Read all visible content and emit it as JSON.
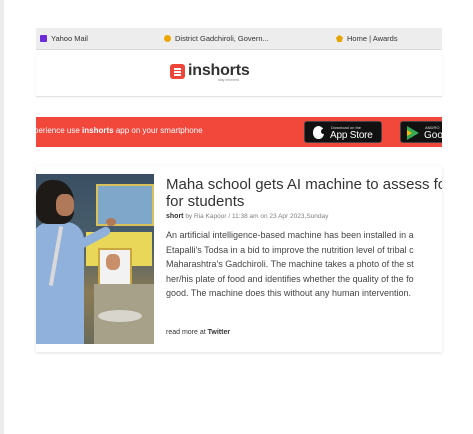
{
  "bookmarks": [
    {
      "label": "Yahoo Mail",
      "icon": "yahoo-mail-icon"
    },
    {
      "label": "District Gadchiroli, Govern...",
      "icon": "government-emblem-icon"
    },
    {
      "label": "Home | Awards",
      "icon": "award-trophy-icon"
    }
  ],
  "header": {
    "logo_text": "inshorts",
    "tagline": "stay informed"
  },
  "banner": {
    "text_before": "perience use ",
    "brand": "inshorts",
    "text_after": " app on your smartphone",
    "app_store_small": "Download on the",
    "app_store_big": "App Store",
    "google_small": "ANDRO",
    "google_big": "Goo",
    "color": "#f2473b"
  },
  "article": {
    "title_line1": "Maha school gets AI machine to assess food",
    "title_line2": "for students",
    "short_label": "short",
    "byline_by": "by",
    "author": "Ria Kapoor",
    "timestamp": "/ 11:38 am on 23 Apr 2023,Sunday",
    "body_lines": [
      "An artificial intelligence-based machine has been installed in a",
      "Etapalli's Todsa in a bid to improve the nutrition level of tribal c",
      "Maharashtra's Gadchiroli. The machine takes a photo of the st",
      "her/his plate of food and identifies whether the quality of the fo",
      "good. The machine does this without any human intervention."
    ],
    "read_more_prefix": "read more at",
    "read_more_source": "Twitter"
  }
}
